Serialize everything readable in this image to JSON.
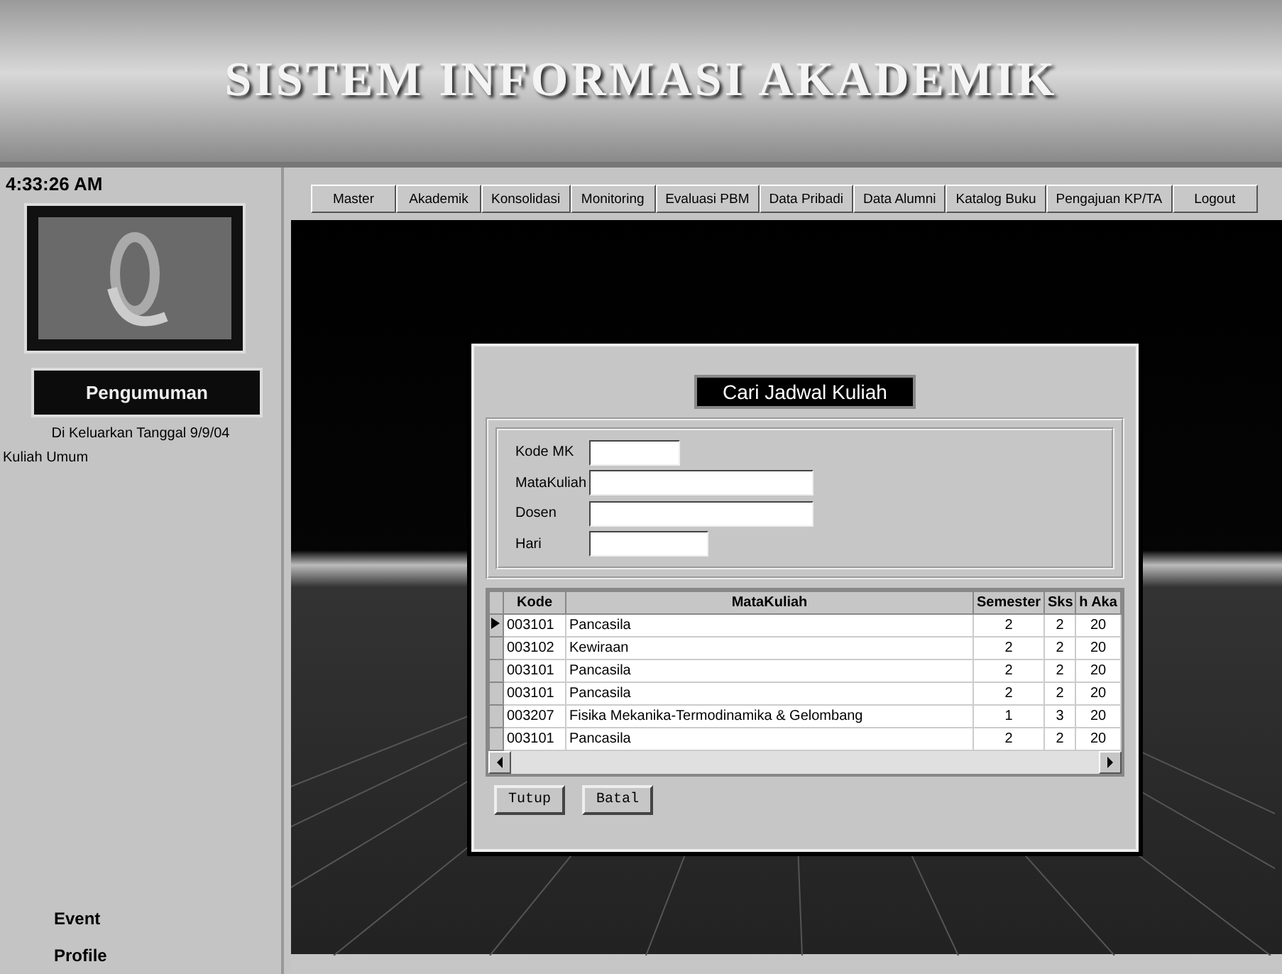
{
  "header": {
    "title": "SISTEM INFORMASI AKADEMIK"
  },
  "sidebar": {
    "clock": "4:33:26 AM",
    "announcement_title": "Pengumuman",
    "issued": "Di Keluarkan Tanggal  9/9/04",
    "announcements": [
      "Kuliah Umum"
    ],
    "links": [
      "Event",
      "Profile"
    ]
  },
  "menu": [
    "Master",
    "Akademik",
    "Konsolidasi",
    "Monitoring",
    "Evaluasi PBM",
    "Data Pribadi",
    "Data Alumni",
    "Katalog Buku",
    "Pengajuan KP/TA",
    "Logout"
  ],
  "dialog": {
    "title": "Cari Jadwal Kuliah",
    "fields": [
      {
        "label": "Kode MK"
      },
      {
        "label": "MataKuliah"
      },
      {
        "label": "Dosen"
      },
      {
        "label": "Hari"
      }
    ],
    "table": {
      "columns": [
        "Kode",
        "MataKuliah",
        "Semester",
        "Sks",
        "h Aka"
      ],
      "rows": [
        {
          "cells": [
            "003101",
            "Pancasila",
            "2",
            "2",
            "20"
          ],
          "selected": true
        },
        {
          "cells": [
            "003102",
            "Kewiraan",
            "2",
            "2",
            "20"
          ],
          "selected": false
        },
        {
          "cells": [
            "003101",
            "Pancasila",
            "2",
            "2",
            "20"
          ],
          "selected": false
        },
        {
          "cells": [
            "003101",
            "Pancasila",
            "2",
            "2",
            "20"
          ],
          "selected": false
        },
        {
          "cells": [
            "003207",
            "Fisika Mekanika-Termodinamika & Gelombang",
            "1",
            "3",
            "20"
          ],
          "selected": false
        },
        {
          "cells": [
            "003101",
            "Pancasila",
            "2",
            "2",
            "20"
          ],
          "selected": false
        }
      ]
    },
    "buttons": [
      "Tutup",
      "Batal"
    ]
  }
}
